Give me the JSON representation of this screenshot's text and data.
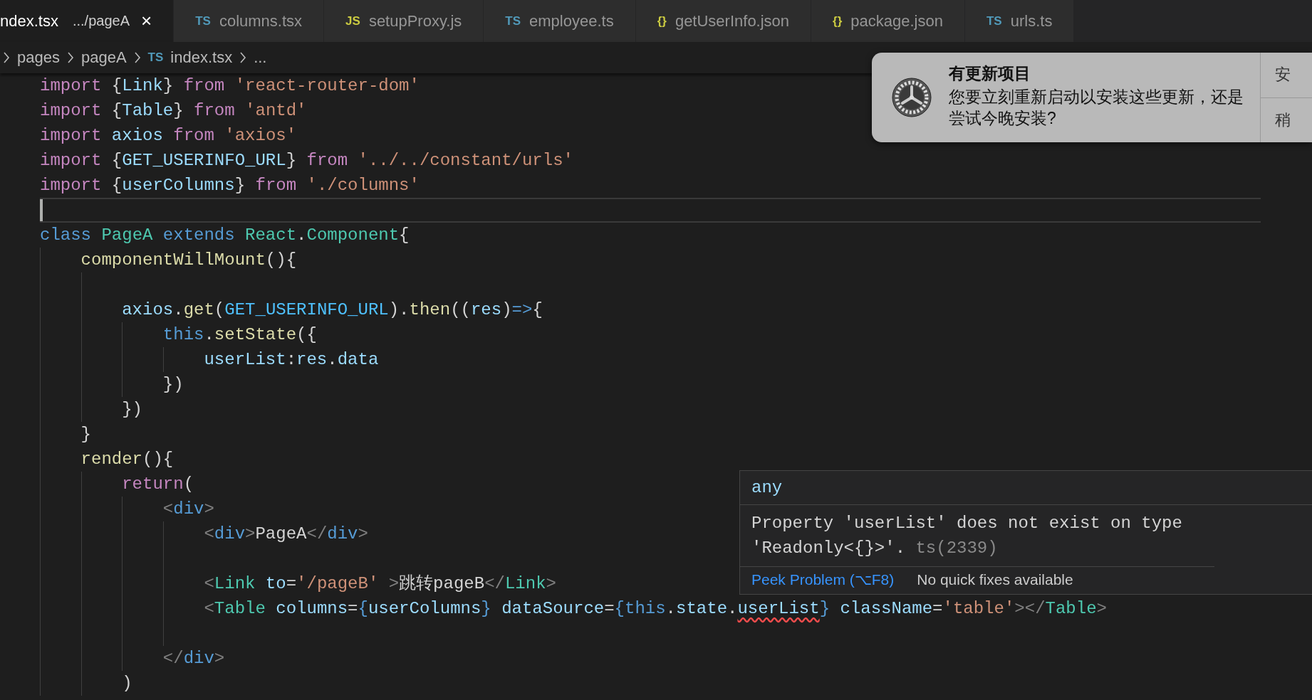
{
  "tabs": [
    {
      "label": "ndex.tsx",
      "description": ".../pageA",
      "close": "×",
      "selected": true
    },
    {
      "badge": "TS",
      "label": "columns.tsx",
      "selected": false
    },
    {
      "badge": "JS",
      "label": "setupProxy.js",
      "selected": false
    },
    {
      "badge": "TS",
      "label": "employee.ts",
      "selected": false
    },
    {
      "badge": "{}",
      "label": "getUserInfo.json",
      "selected": false
    },
    {
      "badge": "{}",
      "label": "package.json",
      "selected": false
    },
    {
      "badge": "TS",
      "label": "urls.ts",
      "selected": false
    }
  ],
  "breadcrumb": [
    {
      "label": "pages"
    },
    {
      "label": "pageA"
    },
    {
      "badge": "TS",
      "label": "index.tsx"
    },
    {
      "label": "..."
    }
  ],
  "code_lines": [
    {
      "current": false,
      "tokens": [
        {
          "kind": "keyword",
          "text": "import "
        },
        {
          "kind": "punct",
          "text": "{"
        },
        {
          "kind": "variable",
          "text": "Link"
        },
        {
          "kind": "punct",
          "text": "} "
        },
        {
          "kind": "keyword",
          "text": "from "
        },
        {
          "kind": "string",
          "text": "'react-router-dom'"
        }
      ]
    },
    {
      "current": false,
      "tokens": [
        {
          "kind": "keyword",
          "text": "import "
        },
        {
          "kind": "punct",
          "text": "{"
        },
        {
          "kind": "variable",
          "text": "Table"
        },
        {
          "kind": "punct",
          "text": "} "
        },
        {
          "kind": "keyword",
          "text": "from "
        },
        {
          "kind": "string",
          "text": "'antd'"
        }
      ]
    },
    {
      "current": false,
      "tokens": [
        {
          "kind": "keyword",
          "text": "import "
        },
        {
          "kind": "variable",
          "text": "axios "
        },
        {
          "kind": "keyword",
          "text": "from "
        },
        {
          "kind": "string",
          "text": "'axios'"
        }
      ]
    },
    {
      "current": false,
      "tokens": [
        {
          "kind": "keyword",
          "text": "import "
        },
        {
          "kind": "punct",
          "text": "{"
        },
        {
          "kind": "variable",
          "text": "GET_USERINFO_URL"
        },
        {
          "kind": "punct",
          "text": "} "
        },
        {
          "kind": "keyword",
          "text": "from "
        },
        {
          "kind": "string",
          "text": "'../../constant/urls'"
        }
      ]
    },
    {
      "current": false,
      "tokens": [
        {
          "kind": "keyword",
          "text": "import "
        },
        {
          "kind": "punct",
          "text": "{"
        },
        {
          "kind": "variable",
          "text": "userColumns"
        },
        {
          "kind": "punct",
          "text": "} "
        },
        {
          "kind": "keyword",
          "text": "from "
        },
        {
          "kind": "string",
          "text": "'./columns'"
        }
      ]
    },
    {
      "current": true
    },
    {
      "current": false,
      "tokens": [
        {
          "kind": "storage",
          "text": "class "
        },
        {
          "kind": "type",
          "text": "PageA "
        },
        {
          "kind": "storage",
          "text": "extends "
        },
        {
          "kind": "type",
          "text": "React"
        },
        {
          "kind": "punct",
          "text": "."
        },
        {
          "kind": "type",
          "text": "Component"
        },
        {
          "kind": "punct",
          "text": "{"
        }
      ],
      "children": [
        {
          "current": false,
          "tokens": [
            {
              "kind": "function",
              "text": "componentWillMount"
            },
            {
              "kind": "punct",
              "text": "(){"
            }
          ],
          "children": [
            {
              "current": false
            },
            {
              "current": false,
              "tokens": [
                {
                  "kind": "variable",
                  "text": "axios"
                },
                {
                  "kind": "punct",
                  "text": "."
                },
                {
                  "kind": "function",
                  "text": "get"
                },
                {
                  "kind": "punct",
                  "text": "("
                },
                {
                  "kind": "constant",
                  "text": "GET_USERINFO_URL"
                },
                {
                  "kind": "punct",
                  "text": ")."
                },
                {
                  "kind": "function",
                  "text": "then"
                },
                {
                  "kind": "punct",
                  "text": "(("
                },
                {
                  "kind": "variable",
                  "text": "res"
                },
                {
                  "kind": "punct",
                  "text": ")"
                },
                {
                  "kind": "storage",
                  "text": "=>"
                },
                {
                  "kind": "punct",
                  "text": "{"
                }
              ],
              "children": [
                {
                  "current": false,
                  "tokens": [
                    {
                      "kind": "storage",
                      "text": "this"
                    },
                    {
                      "kind": "punct",
                      "text": "."
                    },
                    {
                      "kind": "function",
                      "text": "setState"
                    },
                    {
                      "kind": "punct",
                      "text": "({"
                    }
                  ],
                  "children": [
                    {
                      "current": false,
                      "tokens": [
                        {
                          "kind": "variable",
                          "text": "userList"
                        },
                        {
                          "kind": "punct",
                          "text": ":"
                        },
                        {
                          "kind": "variable",
                          "text": "res"
                        },
                        {
                          "kind": "punct",
                          "text": "."
                        },
                        {
                          "kind": "variable",
                          "text": "data"
                        }
                      ]
                    }
                  ]
                },
                {
                  "current": false,
                  "tokens": [
                    {
                      "kind": "punct",
                      "text": "})"
                    }
                  ]
                }
              ]
            },
            {
              "current": false,
              "tokens": [
                {
                  "kind": "punct",
                  "text": "})"
                }
              ]
            }
          ]
        },
        {
          "current": false,
          "tokens": [
            {
              "kind": "punct",
              "text": "}"
            }
          ]
        },
        {
          "current": false,
          "tokens": [
            {
              "kind": "function",
              "text": "render"
            },
            {
              "kind": "punct",
              "text": "(){"
            }
          ],
          "children": [
            {
              "current": false,
              "tokens": [
                {
                  "kind": "keyword",
                  "text": "return"
                },
                {
                  "kind": "punct",
                  "text": "("
                }
              ],
              "children": [
                {
                  "current": false,
                  "tokens": [
                    {
                      "kind": "tagpunct",
                      "text": "<"
                    },
                    {
                      "kind": "tag",
                      "text": "div"
                    },
                    {
                      "kind": "tagpunct",
                      "text": ">"
                    }
                  ],
                  "children": [
                    {
                      "current": false,
                      "tokens": [
                        {
                          "kind": "tagpunct",
                          "text": "<"
                        },
                        {
                          "kind": "tag",
                          "text": "div"
                        },
                        {
                          "kind": "tagpunct",
                          "text": ">"
                        },
                        {
                          "kind": "plain",
                          "text": "PageA"
                        },
                        {
                          "kind": "tagpunct",
                          "text": "</"
                        },
                        {
                          "kind": "tag",
                          "text": "div"
                        },
                        {
                          "kind": "tagpunct",
                          "text": ">"
                        }
                      ]
                    },
                    {
                      "current": false
                    },
                    {
                      "current": false,
                      "tokens": [
                        {
                          "kind": "tagpunct",
                          "text": "<"
                        },
                        {
                          "kind": "type",
                          "text": "Link "
                        },
                        {
                          "kind": "variable",
                          "text": "to"
                        },
                        {
                          "kind": "punct",
                          "text": "="
                        },
                        {
                          "kind": "string",
                          "text": "'/pageB' "
                        },
                        {
                          "kind": "tagpunct",
                          "text": ">"
                        },
                        {
                          "kind": "plain",
                          "text": "跳转pageB"
                        },
                        {
                          "kind": "tagpunct",
                          "text": "</"
                        },
                        {
                          "kind": "type",
                          "text": "Link"
                        },
                        {
                          "kind": "tagpunct",
                          "text": ">"
                        }
                      ]
                    },
                    {
                      "current": false,
                      "tokens": [
                        {
                          "kind": "tagpunct",
                          "text": "<"
                        },
                        {
                          "kind": "type",
                          "text": "Table "
                        },
                        {
                          "kind": "variable",
                          "text": "columns"
                        },
                        {
                          "kind": "punct",
                          "text": "="
                        },
                        {
                          "kind": "storage",
                          "text": "{"
                        },
                        {
                          "kind": "variable",
                          "text": "userColumns"
                        },
                        {
                          "kind": "storage",
                          "text": "} "
                        },
                        {
                          "kind": "variable",
                          "text": "dataSource"
                        },
                        {
                          "kind": "punct",
                          "text": "="
                        },
                        {
                          "kind": "storage",
                          "text": "{this"
                        },
                        {
                          "kind": "punct",
                          "text": "."
                        },
                        {
                          "kind": "variable",
                          "text": "state"
                        },
                        {
                          "kind": "punct",
                          "text": "."
                        },
                        {
                          "kind": "error",
                          "text": "userList"
                        },
                        {
                          "kind": "storage",
                          "text": "} "
                        },
                        {
                          "kind": "variable",
                          "text": "className"
                        },
                        {
                          "kind": "punct",
                          "text": "="
                        },
                        {
                          "kind": "string",
                          "text": "'table'"
                        },
                        {
                          "kind": "tagpunct",
                          "text": "></"
                        },
                        {
                          "kind": "type",
                          "text": "Table"
                        },
                        {
                          "kind": "tagpunct",
                          "text": ">"
                        }
                      ]
                    },
                    {
                      "current": false
                    }
                  ]
                },
                {
                  "current": false,
                  "tokens": [
                    {
                      "kind": "tagpunct",
                      "text": "</"
                    },
                    {
                      "kind": "tag",
                      "text": "div"
                    },
                    {
                      "kind": "tagpunct",
                      "text": ">"
                    }
                  ]
                }
              ]
            },
            {
              "current": false,
              "tokens": [
                {
                  "kind": "punct",
                  "text": ")"
                }
              ]
            }
          ]
        }
      ]
    }
  ],
  "notification": {
    "title": "有更新项目",
    "body": "您要立刻重新启动以安装这些更新，还是尝试今晚安装?",
    "actions": [
      "安",
      "稍"
    ]
  },
  "hover": {
    "type": "any",
    "message": "Property 'userList' does not exist on type 'Readonly<{}>'.",
    "code": "ts(2339)",
    "peek": "Peek Problem (⌥F8)",
    "fixes": "No quick fixes available"
  }
}
